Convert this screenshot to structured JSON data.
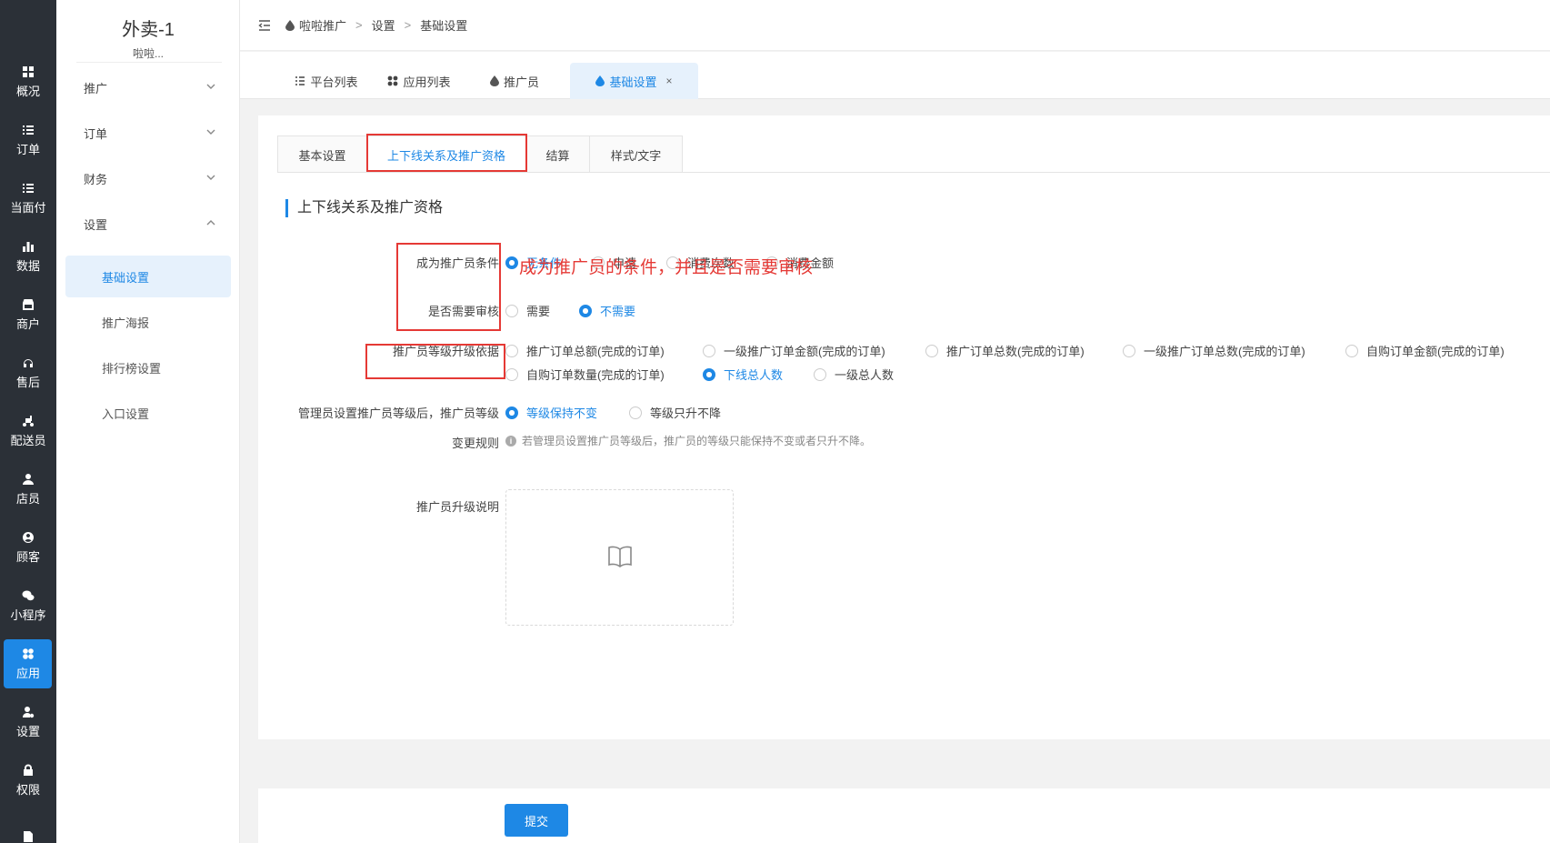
{
  "rail": [
    {
      "label": "概况",
      "icon": "dashboard-icon"
    },
    {
      "label": "订单",
      "icon": "list-icon"
    },
    {
      "label": "当面付",
      "icon": "list-icon"
    },
    {
      "label": "数据",
      "icon": "bar-chart-icon"
    },
    {
      "label": "商户",
      "icon": "store-icon"
    },
    {
      "label": "售后",
      "icon": "headset-icon"
    },
    {
      "label": "配送员",
      "icon": "scooter-icon"
    },
    {
      "label": "店员",
      "icon": "users-icon"
    },
    {
      "label": "顾客",
      "icon": "user-circle-icon"
    },
    {
      "label": "小程序",
      "icon": "wechat-icon"
    },
    {
      "label": "应用",
      "icon": "apps-icon",
      "active": true
    },
    {
      "label": "设置",
      "icon": "user-gear-icon"
    },
    {
      "label": "权限",
      "icon": "lock-icon"
    },
    {
      "label": "",
      "icon": "report-icon"
    }
  ],
  "sidebar": {
    "title": "外卖-1",
    "subtitle": "啦啦...",
    "menu": [
      {
        "label": "推广",
        "expanded": false
      },
      {
        "label": "订单",
        "expanded": false
      },
      {
        "label": "财务",
        "expanded": false
      },
      {
        "label": "设置",
        "expanded": true
      }
    ],
    "submenu": [
      {
        "label": "基础设置",
        "active": true
      },
      {
        "label": "推广海报"
      },
      {
        "label": "排行榜设置"
      },
      {
        "label": "入口设置"
      }
    ]
  },
  "breadcrumb": [
    "啦啦推广",
    "设置",
    "基础设置"
  ],
  "page_tabs": [
    {
      "label": "平台列表",
      "icon": "list-icon"
    },
    {
      "label": "应用列表",
      "icon": "apps-icon"
    },
    {
      "label": "推广员",
      "icon": "drop-icon"
    },
    {
      "label": "基础设置",
      "icon": "drop-icon",
      "active": true,
      "close": "×"
    }
  ],
  "sub_tabs": [
    {
      "label": "基本设置"
    },
    {
      "label": "上下线关系及推广资格",
      "active": true
    },
    {
      "label": "结算"
    },
    {
      "label": "样式/文字"
    }
  ],
  "section_title": "上下线关系及推广资格",
  "form": {
    "condition": {
      "label": "成为推广员条件",
      "options": [
        "无条件",
        "申请",
        "消费次数",
        "消费金额"
      ],
      "selected": 0
    },
    "review": {
      "label": "是否需要审核",
      "options": [
        "需要",
        "不需要"
      ],
      "selected": 1
    },
    "upgrade": {
      "label": "推广员等级升级依据",
      "options": [
        "推广订单总额(完成的订单)",
        "一级推广订单金额(完成的订单)",
        "推广订单总数(完成的订单)",
        "一级推广订单总数(完成的订单)",
        "自购订单金额(完成的订单)",
        "自购订单数量(完成的订单)",
        "下线总人数",
        "一级总人数"
      ],
      "selected": 6
    },
    "admin_level": {
      "label": "管理员设置推广员等级后，推广员等级",
      "options": [
        "等级保持不变",
        "等级只升不降"
      ],
      "selected": 0
    },
    "change_rule": {
      "label": "变更规则",
      "hint": "若管理员设置推广员等级后，推广员的等级只能保持不变或者只升不降。"
    },
    "upgrade_desc": {
      "label": "推广员升级说明"
    }
  },
  "annotation": "成为推广员的条件，并且是否需要审核",
  "submit_label": "提交",
  "colors": {
    "accent": "#1e88e5",
    "rail_bg": "#2b3037",
    "annotation_red": "#e53935"
  }
}
